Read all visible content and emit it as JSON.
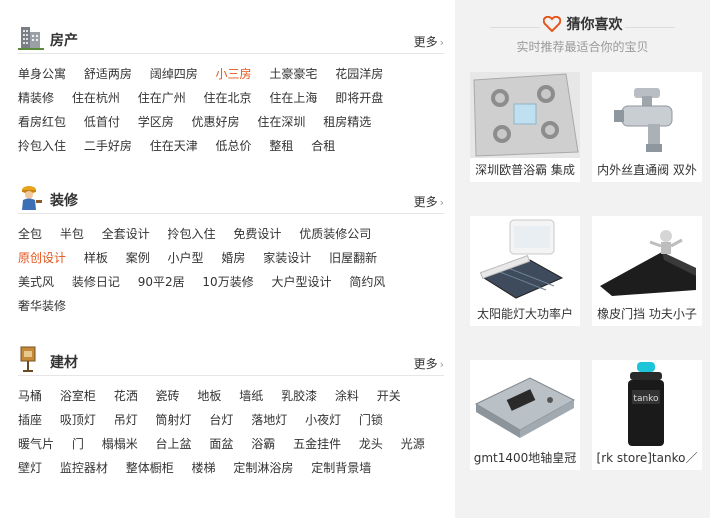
{
  "sections": [
    {
      "title": "房产",
      "more": "更多",
      "icon": "building-icon",
      "links": [
        {
          "text": "单身公寓"
        },
        {
          "text": "舒适两房"
        },
        {
          "text": "阔绰四房"
        },
        {
          "text": "小三房",
          "hot": true
        },
        {
          "text": "土豪豪宅"
        },
        {
          "text": "花园洋房"
        },
        {
          "text": "精装修"
        },
        {
          "text": "住在杭州"
        },
        {
          "text": "住在广州"
        },
        {
          "text": "住在北京"
        },
        {
          "text": "住在上海"
        },
        {
          "text": "即将开盘"
        },
        {
          "text": "看房红包"
        },
        {
          "text": "低首付"
        },
        {
          "text": "学区房"
        },
        {
          "text": "优惠好房"
        },
        {
          "text": "住在深圳"
        },
        {
          "text": "租房精选"
        },
        {
          "text": "拎包入住"
        },
        {
          "text": "二手好房"
        },
        {
          "text": "住在天津"
        },
        {
          "text": "低总价"
        },
        {
          "text": "整租"
        },
        {
          "text": "合租"
        }
      ]
    },
    {
      "title": "装修",
      "more": "更多",
      "icon": "worker-icon",
      "links": [
        {
          "text": "全包"
        },
        {
          "text": "半包"
        },
        {
          "text": "全套设计"
        },
        {
          "text": "拎包入住"
        },
        {
          "text": "免费设计"
        },
        {
          "text": "优质装修公司"
        },
        {
          "text": "原创设计",
          "hot": true
        },
        {
          "text": "样板"
        },
        {
          "text": "案例"
        },
        {
          "text": "小户型"
        },
        {
          "text": "婚房"
        },
        {
          "text": "家装设计"
        },
        {
          "text": "旧屋翻新"
        },
        {
          "text": "美式风"
        },
        {
          "text": "装修日记"
        },
        {
          "text": "90平2居"
        },
        {
          "text": "10万装修"
        },
        {
          "text": "大户型设计"
        },
        {
          "text": "简约风"
        },
        {
          "text": "奢华装修"
        }
      ]
    },
    {
      "title": "建材",
      "more": "更多",
      "icon": "signpost-icon",
      "links": [
        {
          "text": "马桶"
        },
        {
          "text": "浴室柜"
        },
        {
          "text": "花洒"
        },
        {
          "text": "瓷砖"
        },
        {
          "text": "地板"
        },
        {
          "text": "墙纸"
        },
        {
          "text": "乳胶漆"
        },
        {
          "text": "涂料"
        },
        {
          "text": "开关"
        },
        {
          "text": "插座"
        },
        {
          "text": "吸顶灯"
        },
        {
          "text": "吊灯"
        },
        {
          "text": "筒射灯"
        },
        {
          "text": "台灯"
        },
        {
          "text": "落地灯"
        },
        {
          "text": "小夜灯"
        },
        {
          "text": "门锁"
        },
        {
          "text": "暖气片"
        },
        {
          "text": "门"
        },
        {
          "text": "榻榻米"
        },
        {
          "text": "台上盆"
        },
        {
          "text": "面盆"
        },
        {
          "text": "浴霸"
        },
        {
          "text": "五金挂件"
        },
        {
          "text": "龙头"
        },
        {
          "text": "光源"
        },
        {
          "text": "壁灯"
        },
        {
          "text": "监控器材"
        },
        {
          "text": "整体橱柜"
        },
        {
          "text": "楼梯"
        },
        {
          "text": "定制淋浴房"
        },
        {
          "text": "定制背景墙"
        }
      ]
    }
  ],
  "guess": {
    "title": "猜你喜欢",
    "subtitle": "实时推荐最适合你的宝贝",
    "accent": "#e4561c",
    "products": [
      {
        "caption": "深圳欧普浴霸 集成",
        "icon": "bath-heater-icon"
      },
      {
        "caption": "内外丝直通阀 双外",
        "icon": "valve-icon"
      },
      {
        "caption": "太阳能灯大功率户",
        "icon": "solar-lamp-icon"
      },
      {
        "caption": "橡皮门挡 功夫小子",
        "icon": "door-stopper-icon"
      },
      {
        "caption": "gmt1400地轴皇冠",
        "icon": "floor-hinge-icon"
      },
      {
        "caption": "[rk store]tanko／",
        "icon": "spray-can-icon"
      }
    ]
  }
}
